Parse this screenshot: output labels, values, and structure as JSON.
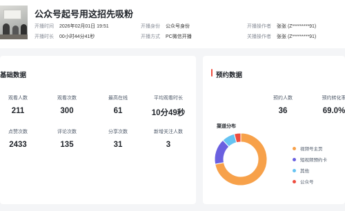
{
  "header": {
    "title": "公众号起号用这招先吸粉",
    "meta": [
      {
        "key": "开播时间",
        "value": "2026年02月01日 19:51"
      },
      {
        "key": "开播时长",
        "value": "00小时44分41秒"
      },
      {
        "key": "开播身份",
        "value": "公众号身份"
      },
      {
        "key": "开播方式",
        "value": "PC微信开播"
      },
      {
        "key": "开播操作者",
        "value": "张张 (Z*********91)"
      },
      {
        "key": "关播操作者",
        "value": "张张 (Z*********91)"
      }
    ]
  },
  "basic": {
    "title": "基础数据",
    "stats": [
      {
        "label": "观看人数",
        "value": "211"
      },
      {
        "label": "观看次数",
        "value": "300"
      },
      {
        "label": "最高在线",
        "value": "61"
      },
      {
        "label": "平均观看时长",
        "value": "10分49秒"
      },
      {
        "label": "点赞次数",
        "value": "2433"
      },
      {
        "label": "评论次数",
        "value": "135"
      },
      {
        "label": "分享次数",
        "value": "31"
      },
      {
        "label": "新增关注人数",
        "value": "3"
      }
    ]
  },
  "booking": {
    "title": "预约数据",
    "stats": [
      {
        "label": "预约人数",
        "value": "36"
      },
      {
        "label": "预约转化率",
        "value": "69.0%"
      }
    ],
    "channel_title": "渠道分布",
    "accent_color": "#ee4d3f"
  },
  "chart_data": {
    "type": "pie",
    "title": "渠道分布",
    "categories": [
      "视频号主页",
      "短视频预约卡",
      "其他",
      "公众号"
    ],
    "values": [
      72,
      16,
      8,
      4
    ],
    "colors": [
      "#f7a14a",
      "#6a60e0",
      "#66c3f2",
      "#ee4d3f"
    ],
    "legend": "right"
  }
}
